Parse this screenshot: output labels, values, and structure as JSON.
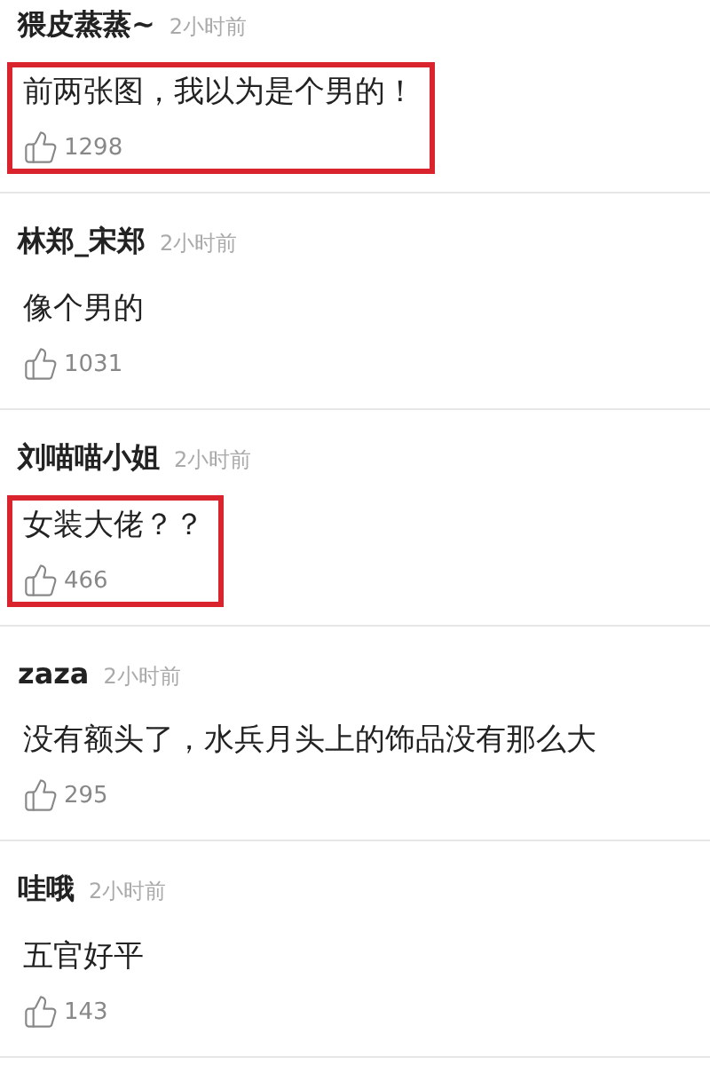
{
  "comments": [
    {
      "user": "猥皮蒸蒸~",
      "time": "2小时前",
      "text": "前两张图，我以为是个男的！",
      "likes": "1298",
      "highlighted": true
    },
    {
      "user": "林郑_宋郑",
      "time": "2小时前",
      "text": "像个男的",
      "likes": "1031",
      "highlighted": false
    },
    {
      "user": "刘喵喵小姐",
      "time": "2小时前",
      "text": "女装大佬？？",
      "likes": "466",
      "highlighted": true
    },
    {
      "user": "zaza",
      "time": "2小时前",
      "text": "没有额头了，水兵月头上的饰品没有那么大",
      "likes": "295",
      "highlighted": false
    },
    {
      "user": "哇哦",
      "time": "2小时前",
      "text": "五官好平",
      "likes": "143",
      "highlighted": false
    }
  ]
}
